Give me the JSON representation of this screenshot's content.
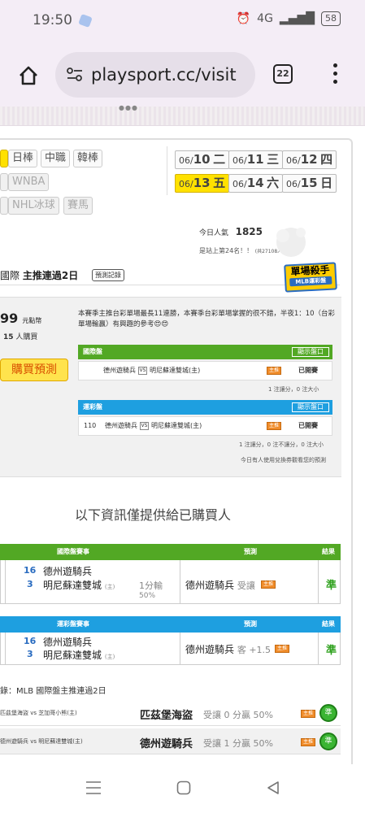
{
  "status": {
    "time": "19:50",
    "alarm_icon": "alarm-icon",
    "network": "4G",
    "battery": "58"
  },
  "browser": {
    "url": "playsport.cc/visit",
    "tabs_count": "22"
  },
  "leagues": {
    "row1": [
      "日棒",
      "中職",
      "韓棒"
    ],
    "row2": [
      "WNBA"
    ],
    "row3": [
      "NHL冰球",
      "賽馬"
    ]
  },
  "dates": {
    "row1": [
      {
        "md": "06/",
        "d": "10",
        "w": "二"
      },
      {
        "md": "06/",
        "d": "11",
        "w": "三"
      },
      {
        "md": "06/",
        "d": "12",
        "w": "四"
      }
    ],
    "row2": [
      {
        "md": "06/",
        "d": "13",
        "w": "五"
      },
      {
        "md": "06/",
        "d": "14",
        "w": "六"
      },
      {
        "md": "06/",
        "d": "15",
        "w": "日"
      }
    ]
  },
  "popularity": {
    "label": "今日人氣",
    "value": "1825",
    "rank": "是站上第24名！！",
    "rank_note": "(共27108人)"
  },
  "heading": {
    "prefix": "國際",
    "bold": "主推連過2日",
    "history_btn": "預測記錄"
  },
  "badge": {
    "title": "單場殺手",
    "sub": "MLB運彩盤"
  },
  "price": {
    "amount": "99",
    "unit": "元點幣",
    "buyers_count": "15",
    "buyers_label": "人購買",
    "buy_btn": "購買預測"
  },
  "intro": "本賽季主推台彩單場最長11連勝，本賽季台彩單場掌握的很不錯，半夜1：10（台彩單場輸贏）有興趣的參考😍😍",
  "intl_panel": {
    "header": "國際盤",
    "show": "顯示盤口",
    "away": "德州遊騎兵",
    "home": "明尼蘇達雙城(主)",
    "status": "已開賽",
    "footer": "1 注讓分，0 注大小"
  },
  "tw_panel": {
    "header": "運彩盤",
    "show": "顯示盤口",
    "num": "110",
    "away": "德州遊騎兵",
    "home": "明尼蘇達雙城(主)",
    "status": "已開賽",
    "footer": "1 注讓分，0 注不讓分，0 注大小",
    "note": "今日有人使用兌換券觀看您的預測"
  },
  "notice": "以下資訊僅提供給已購買人",
  "table1": {
    "h_game": "國際盤賽事",
    "h_pred": "預測",
    "h_res": "結果",
    "s1": "16",
    "t1": "德州遊騎兵",
    "s2": "3",
    "t2": "明尼蘇達雙城",
    "home_tag": "(主)",
    "line": "1分輸",
    "pct": "50%",
    "pick": "德州遊騎兵",
    "hand": "受讓",
    "result": "準"
  },
  "table2": {
    "h_game": "運彩盤賽事",
    "h_pred": "預測",
    "h_res": "結果",
    "s1": "16",
    "t1": "德州遊騎兵",
    "s2": "3",
    "t2": "明尼蘇達雙城",
    "home_tag": "(主)",
    "pick": "德州遊騎兵",
    "hand": "客 +1.5",
    "result": "準"
  },
  "records": {
    "title": "錄：MLB 國際盤主推連過2日",
    "rows": [
      {
        "game": "匹茲堡海盜 vs 芝加哥小熊(主)",
        "pick": "匹茲堡海盜",
        "detail": "受讓 0 分贏 50%",
        "res": "準"
      },
      {
        "game": "德州遊騎兵 vs 明尼蘇達雙城(主)",
        "pick": "德州遊騎兵",
        "detail": "受讓 1 分贏 50%",
        "res": "準"
      }
    ]
  },
  "fv_tag": "主推",
  "vs_tag": "VS"
}
